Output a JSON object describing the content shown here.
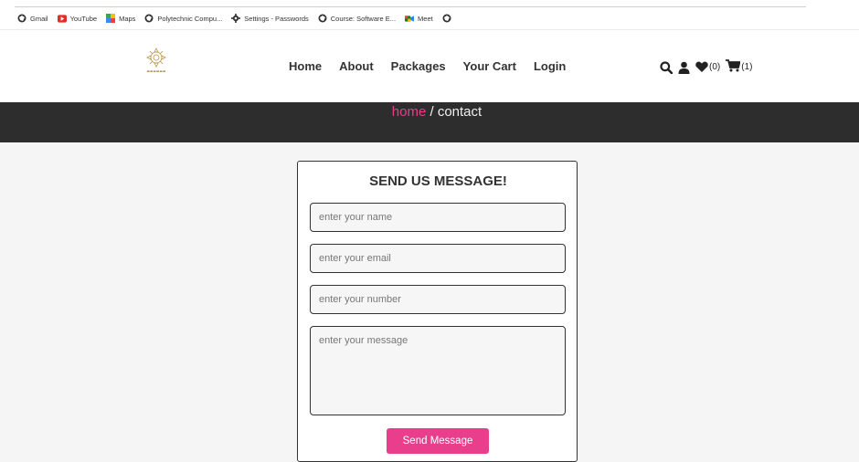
{
  "bookmarks": [
    {
      "label": "Gmail",
      "icon": "globe-icon"
    },
    {
      "label": "YouTube",
      "icon": "youtube-icon"
    },
    {
      "label": "Maps",
      "icon": "maps-icon"
    },
    {
      "label": "Polytechnic Compu...",
      "icon": "globe-icon"
    },
    {
      "label": "Settings - Passwords",
      "icon": "gear-icon"
    },
    {
      "label": "Course: Software E...",
      "icon": "globe-icon"
    },
    {
      "label": "Meet",
      "icon": "meet-icon"
    },
    {
      "label": "",
      "icon": "globe-icon"
    }
  ],
  "nav": {
    "items": [
      "Home",
      "About",
      "Packages",
      "Your Cart",
      "Login"
    ]
  },
  "header_icons": {
    "wishlist_count": "(0)",
    "cart_count": "(1)"
  },
  "breadcrumb": {
    "home": "home",
    "separator": " / ",
    "current": "contact"
  },
  "form": {
    "title": "SEND US MESSAGE!",
    "name_placeholder": "enter your name",
    "email_placeholder": "enter your email",
    "number_placeholder": "enter your number",
    "message_placeholder": "enter your message",
    "submit_label": "Send Message"
  },
  "colors": {
    "accent": "#e83e8c",
    "banner": "#2d2d2d"
  }
}
